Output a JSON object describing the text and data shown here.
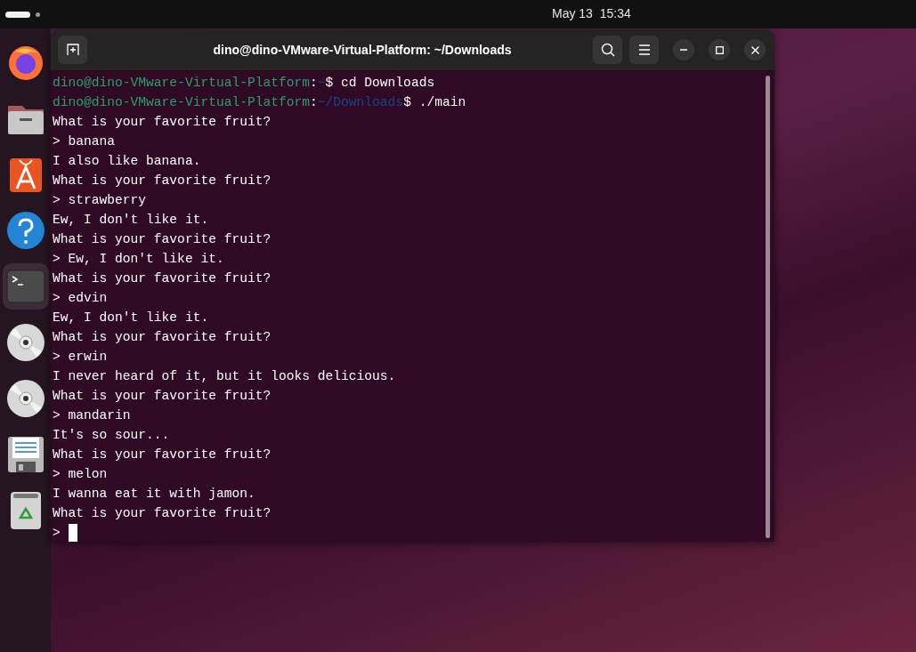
{
  "top_bar": {
    "clock": "May 13  15:34"
  },
  "dock": [
    {
      "kind": "browser",
      "selected": false
    },
    {
      "kind": "files",
      "selected": false
    },
    {
      "kind": "store",
      "selected": false
    },
    {
      "kind": "help",
      "selected": false
    },
    {
      "kind": "terminal",
      "selected": true
    },
    {
      "kind": "disc",
      "selected": false
    },
    {
      "kind": "disc",
      "selected": false
    },
    {
      "kind": "floppy",
      "selected": false
    },
    {
      "kind": "trash",
      "selected": false
    }
  ],
  "window": {
    "title": "dino@dino-VMware-Virtual-Platform: ~/Downloads"
  },
  "terminal": {
    "lines": [
      {
        "kind": "prompt",
        "user": "dino@dino-VMware-Virtual-Platform",
        "separator": ":",
        "path": "~",
        "command": "$ cd Downloads"
      },
      {
        "kind": "prompt",
        "user": "dino@dino-VMware-Virtual-Platform",
        "separator": ":",
        "path": "~/Downloads",
        "command": "$ ./main"
      },
      {
        "kind": "output",
        "text": "What is your favorite fruit?"
      },
      {
        "kind": "output",
        "text": "> banana"
      },
      {
        "kind": "output",
        "text": "I also like banana."
      },
      {
        "kind": "output",
        "text": "What is your favorite fruit?"
      },
      {
        "kind": "output",
        "text": "> strawberry"
      },
      {
        "kind": "output",
        "text": "Ew, I don't like it."
      },
      {
        "kind": "output",
        "text": "What is your favorite fruit?"
      },
      {
        "kind": "output",
        "text": "> Ew, I don't like it."
      },
      {
        "kind": "output",
        "text": "What is your favorite fruit?"
      },
      {
        "kind": "output",
        "text": "> edvin"
      },
      {
        "kind": "output",
        "text": "Ew, I don't like it."
      },
      {
        "kind": "output",
        "text": "What is your favorite fruit?"
      },
      {
        "kind": "output",
        "text": "> erwin"
      },
      {
        "kind": "output",
        "text": "I never heard of it, but it looks delicious."
      },
      {
        "kind": "output",
        "text": "What is your favorite fruit?"
      },
      {
        "kind": "output",
        "text": "> mandarin"
      },
      {
        "kind": "output",
        "text": "It's so sour..."
      },
      {
        "kind": "output",
        "text": "What is your favorite fruit?"
      },
      {
        "kind": "output",
        "text": "> melon"
      },
      {
        "kind": "output",
        "text": "I wanna eat it with jamon."
      },
      {
        "kind": "output",
        "text": "What is your favorite fruit?"
      },
      {
        "kind": "input",
        "text": ">"
      }
    ]
  }
}
